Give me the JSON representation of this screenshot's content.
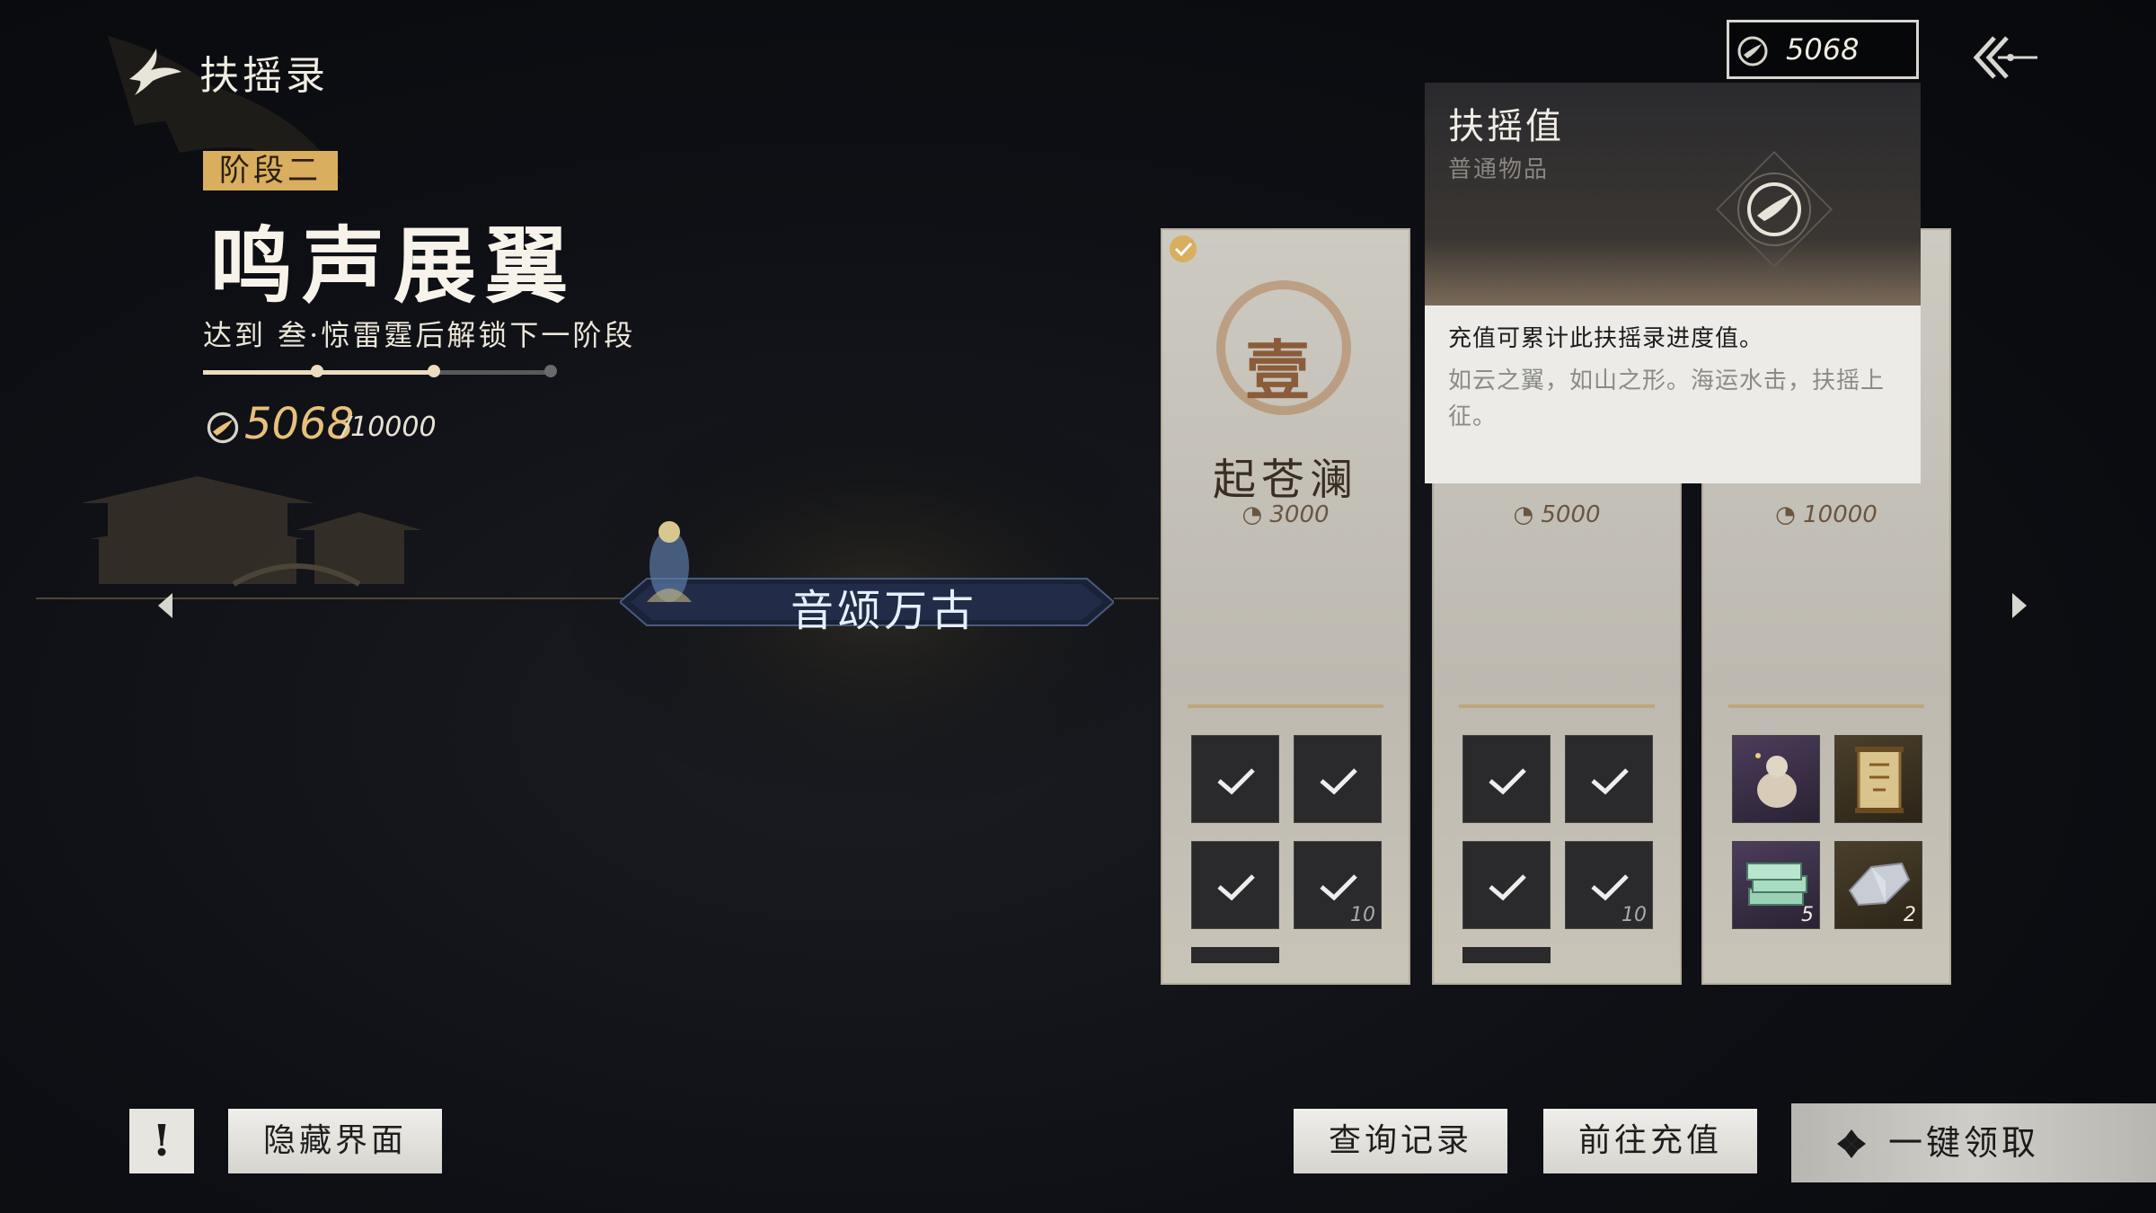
{
  "header": {
    "title": "扶摇录",
    "currency_value": "5068"
  },
  "stage": {
    "badge": "阶段二",
    "name": "鸣声展翼",
    "description": "达到 叁·惊雷霆后解锁下一阶段",
    "progress_nodes_reached": 2,
    "progress_nodes_total": 3,
    "points_current": "5068",
    "points_total": "/10000"
  },
  "banner": {
    "text": "音颂万古"
  },
  "cards": [
    {
      "numeral": "壹",
      "name": "起苍澜",
      "cost": "3000",
      "claimed": true,
      "slots": [
        {
          "icon": "wing-icon",
          "claimed": true,
          "count": ""
        },
        {
          "icon": "robe-icon",
          "claimed": true,
          "count": ""
        },
        {
          "icon": "reed-icon",
          "claimed": true,
          "count": ""
        },
        {
          "icon": "coin-icon",
          "claimed": true,
          "count": "10"
        }
      ]
    },
    {
      "numeral": "",
      "name": "",
      "cost": "5000",
      "claimed": false,
      "slots": [
        {
          "icon": "robe-icon",
          "claimed": true,
          "count": ""
        },
        {
          "icon": "staff-icon",
          "claimed": true,
          "count": ""
        },
        {
          "icon": "mask-icon",
          "claimed": true,
          "count": ""
        },
        {
          "icon": "coin-icon",
          "claimed": true,
          "count": "10"
        }
      ]
    },
    {
      "numeral": "",
      "name": "",
      "cost": "10000",
      "claimed": false,
      "slots": [
        {
          "icon": "pet-icon",
          "claimed": false,
          "count": ""
        },
        {
          "icon": "scroll-icon",
          "claimed": false,
          "count": ""
        },
        {
          "icon": "money-stack-icon",
          "claimed": false,
          "count": "5"
        },
        {
          "icon": "crystal-icon",
          "claimed": false,
          "count": "2"
        }
      ]
    }
  ],
  "tooltip": {
    "title": "扶摇值",
    "type": "普通物品",
    "description": "充值可累计此扶摇录进度值。",
    "flavor": "如云之翼，如山之形。海运水击，扶摇上征。"
  },
  "footer": {
    "help_label": "!",
    "hide_label": "隐藏界面",
    "history_label": "查询记录",
    "recharge_label": "前往充值",
    "claim_label": "一键领取"
  },
  "colors": {
    "accent_gold": "#d9ae5e",
    "points_gold": "#e7c07a",
    "card_bg": "#c6c2b9",
    "button_bg": "#e6e5e0"
  }
}
